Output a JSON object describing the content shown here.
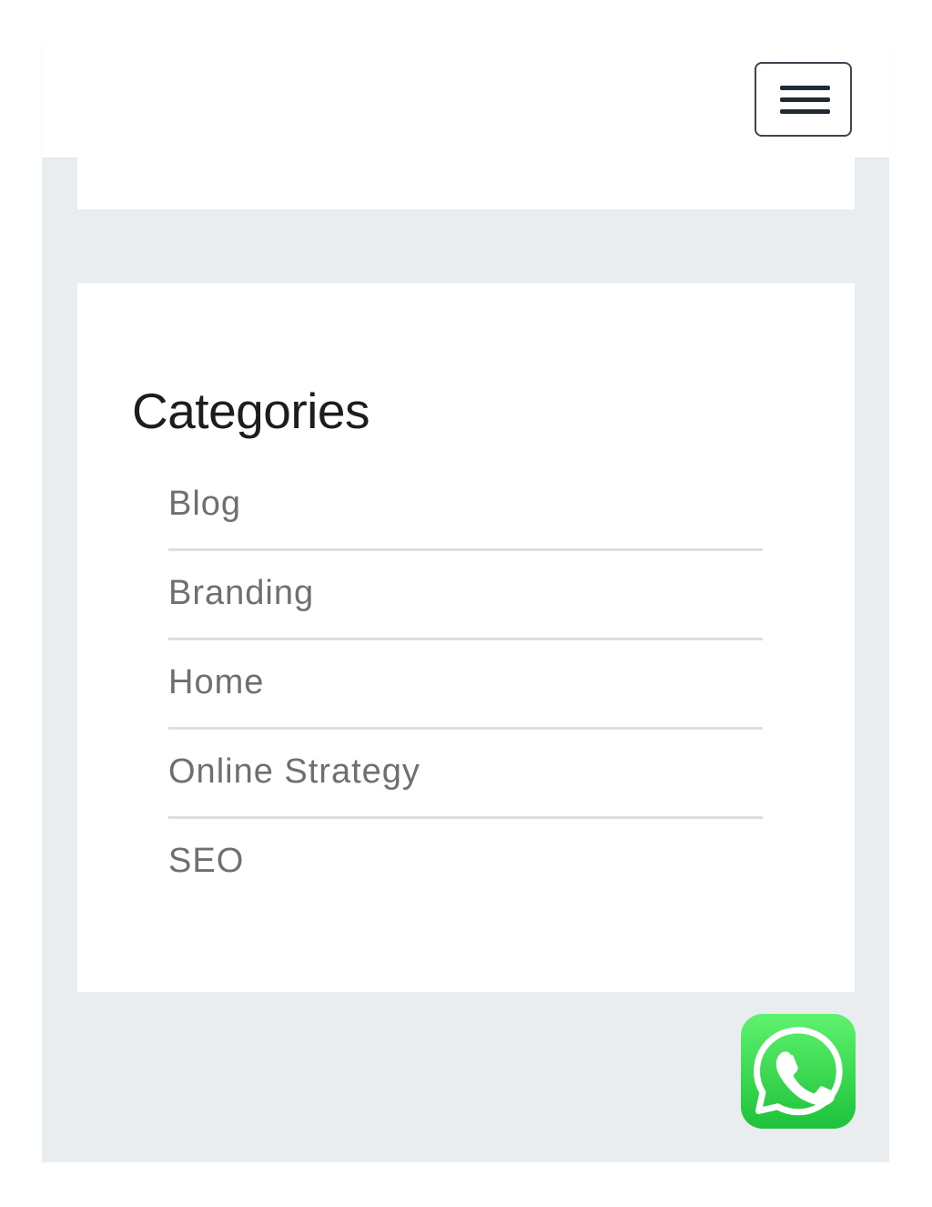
{
  "header": {
    "menu_toggle_icon": "hamburger-menu-icon"
  },
  "categories": {
    "title": "Categories",
    "items": [
      {
        "label": "Blog"
      },
      {
        "label": "Branding"
      },
      {
        "label": "Home"
      },
      {
        "label": "Online Strategy"
      },
      {
        "label": "SEO"
      }
    ]
  },
  "floating": {
    "whatsapp_icon": "whatsapp-icon",
    "whatsapp_color": "#25D366"
  },
  "colors": {
    "page_background": "#e9edf0",
    "card_background": "#ffffff",
    "title_text": "#1d1d1f",
    "link_text": "#6f6f73",
    "divider": "#dcdfe2"
  }
}
